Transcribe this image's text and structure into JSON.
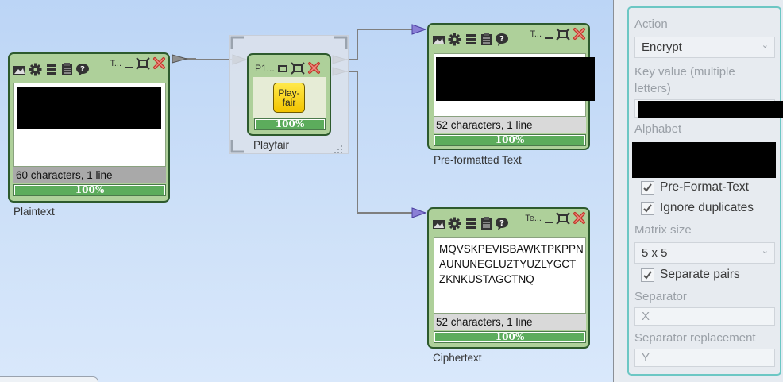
{
  "components": {
    "plaintext": {
      "title": "T...",
      "info": "60 characters,  1 line",
      "progress_label": "100%",
      "progress": 1.0,
      "caption": "Plaintext"
    },
    "playfair": {
      "title": "P1...",
      "icon_label": "Play-fair",
      "progress_label": "100%",
      "progress": 1.0,
      "caption": "Playfair"
    },
    "preformatted": {
      "title": "T...",
      "info": "52 characters,  1 line",
      "progress_label": "100%",
      "progress": 1.0,
      "caption": "Pre-formatted Text"
    },
    "ciphertext": {
      "title": "Te...",
      "text_lines": [
        "MQVSKPEVISBAWKTPKPPN",
        "AUNUNEGLUZTYUZLYGCT",
        "ZKNKUSTAGCTNQ"
      ],
      "info": "52 characters,  1 line",
      "progress_label": "100%",
      "progress": 1.0,
      "caption": "Ciphertext"
    }
  },
  "settings": {
    "action_label": "Action",
    "action_value": "Encrypt",
    "key_label": "Key value (multiple letters)",
    "alphabet_label": "Alphabet",
    "preformat_label": "Pre-Format-Text",
    "ignore_duplicates_label": "Ignore duplicates",
    "matrix_size_label": "Matrix size",
    "matrix_size_value": "5 x 5",
    "separate_pairs_label": "Separate pairs",
    "separator_label": "Separator",
    "separator_value": "X",
    "separator_replacement_label": "Separator replacement",
    "separator_replacement_value": "Y"
  },
  "colors": {
    "canvas_bg": "#c7dcf7",
    "component_bg": "#aed09a",
    "component_border": "#2d5a2d",
    "progress_fill": "#5cac5c",
    "connector_arrow": "#8a7fd6",
    "settings_border": "#6cc7c4"
  }
}
